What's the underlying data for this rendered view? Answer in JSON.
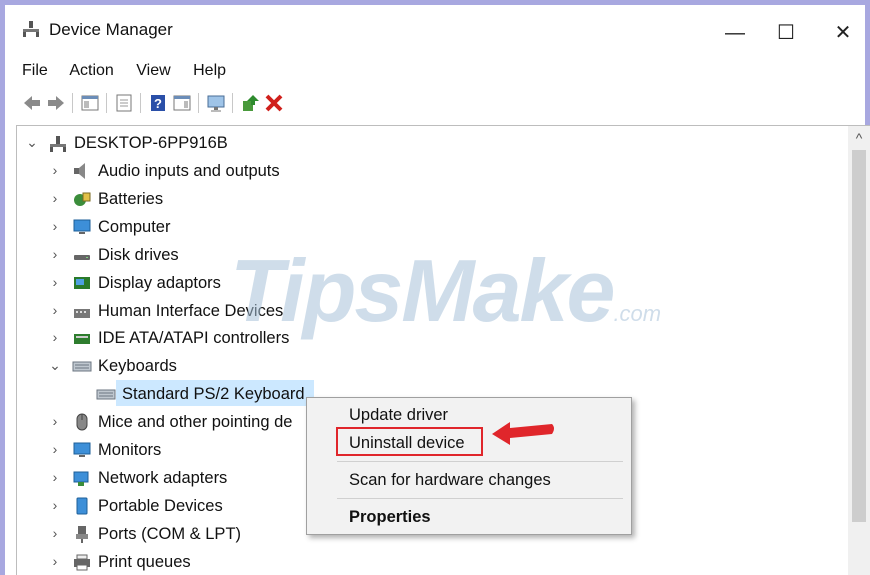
{
  "window": {
    "title": "Device Manager",
    "minimize": "—",
    "maximize": "☐",
    "close": "✕"
  },
  "menu": [
    "File",
    "Action",
    "View",
    "Help"
  ],
  "tree": {
    "root": "DESKTOP-6PP916B",
    "items": [
      {
        "label": "Audio inputs and outputs",
        "icon": "speaker-icon",
        "expanded": false
      },
      {
        "label": "Batteries",
        "icon": "battery-icon",
        "expanded": false
      },
      {
        "label": "Computer",
        "icon": "monitor-icon",
        "expanded": false
      },
      {
        "label": "Disk drives",
        "icon": "disk-icon",
        "expanded": false
      },
      {
        "label": "Display adaptors",
        "icon": "display-adapter-icon",
        "expanded": false
      },
      {
        "label": "Human Interface Devices",
        "icon": "hid-icon",
        "expanded": false
      },
      {
        "label": "IDE ATA/ATAPI controllers",
        "icon": "ide-icon",
        "expanded": false
      },
      {
        "label": "Keyboards",
        "icon": "keyboard-icon",
        "expanded": true
      },
      {
        "label": "Standard PS/2 Keyboard",
        "icon": "keyboard-icon",
        "child": true,
        "selected": true
      },
      {
        "label": "Mice and other pointing de",
        "icon": "mouse-icon",
        "expanded": false
      },
      {
        "label": "Monitors",
        "icon": "monitor-icon",
        "expanded": false
      },
      {
        "label": "Network adapters",
        "icon": "network-icon",
        "expanded": false
      },
      {
        "label": "Portable Devices",
        "icon": "portable-icon",
        "expanded": false
      },
      {
        "label": "Ports (COM & LPT)",
        "icon": "port-icon",
        "expanded": false
      },
      {
        "label": "Print queues",
        "icon": "printer-icon",
        "expanded": false
      }
    ]
  },
  "context_menu": {
    "update": "Update driver",
    "uninstall": "Uninstall device",
    "scan": "Scan for hardware changes",
    "properties": "Properties"
  },
  "watermark": {
    "main": "TipsMake",
    "suffix": ".com"
  },
  "colors": {
    "selection": "#cce8ff",
    "highlight": "#e0262b",
    "frame": "#a8a8e0"
  }
}
